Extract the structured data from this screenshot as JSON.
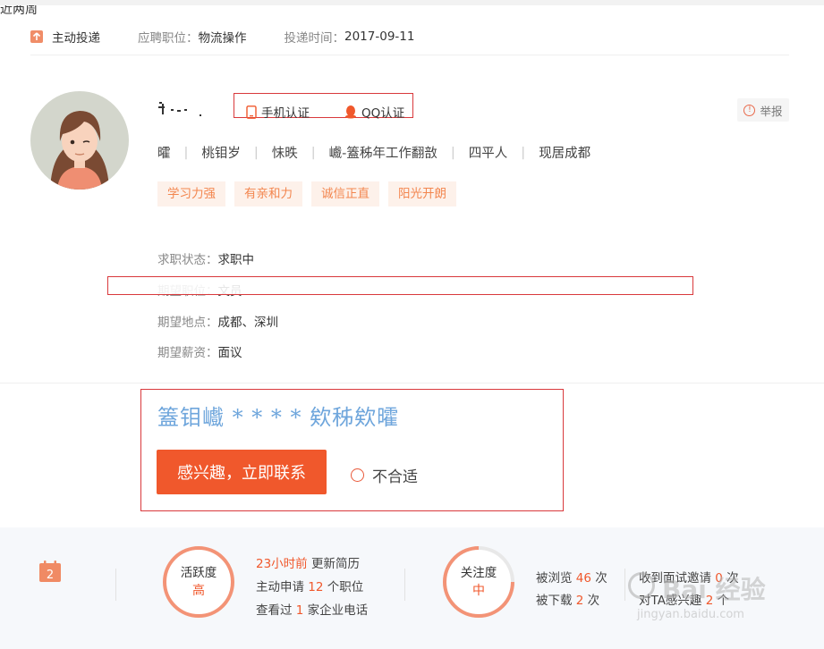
{
  "apply": {
    "mode": "主动投递",
    "position_label": "应聘职位：",
    "position_value": "物流操作",
    "time_label": "投递时间：",
    "time_value": "2017-09-11"
  },
  "verify": {
    "phone": "手机认证",
    "qq": "QQ认证"
  },
  "report_label": "举报",
  "info": [
    "曤",
    "桃钼岁",
    "怽昳",
    "巇-篕秭年工作翻敨",
    "四平人",
    "现居成都"
  ],
  "tags": [
    "学习力强",
    "有亲和力",
    "诚信正直",
    "阳光开朗"
  ],
  "intent": {
    "status_label": "求职状态：",
    "status_value": "求职中",
    "position_label": "期望职位：",
    "position_value": "文员",
    "location_label": "期望地点：",
    "location_value": "成都、深圳",
    "salary_label": "期望薪资：",
    "salary_value": "面议"
  },
  "job_title": "篕钼巇 * * * * 欸秭欸曤",
  "actions": {
    "contact": "感兴趣，立即联系",
    "reject": "不合适"
  },
  "stats": {
    "calendar_day": "2",
    "period": "近两周",
    "activity_label": "活跃度",
    "activity_value": "高",
    "updated_time": "23小时前",
    "updated_text": " 更新简历",
    "applied_prefix": "主动申请 ",
    "applied_count": "12",
    "applied_suffix": " 个职位",
    "viewed_prefix": "查看过 ",
    "viewed_count": "1",
    "viewed_suffix": " 家企业电话",
    "attention_label": "关注度",
    "attention_value": "中",
    "browsed_prefix": "被浏览 ",
    "browsed_count": "46",
    "browsed_suffix": " 次",
    "downloaded_prefix": "被下载 ",
    "downloaded_count": "2",
    "downloaded_suffix": " 次",
    "interview_prefix": "收到面试邀请 ",
    "interview_count": "0",
    "interview_suffix": " 次",
    "interest_prefix": "对TA感兴趣 ",
    "interest_count": "2",
    "interest_suffix": " 个"
  },
  "watermark": {
    "brand": "Bai 经验",
    "url": "jingyan.baidu.com"
  },
  "colors": {
    "accent": "#f0582c",
    "tag_bg": "#fdf1ea",
    "tag_text": "#f3864f",
    "link_blue": "#6fa6dc",
    "annotation_red": "#d9393c"
  }
}
